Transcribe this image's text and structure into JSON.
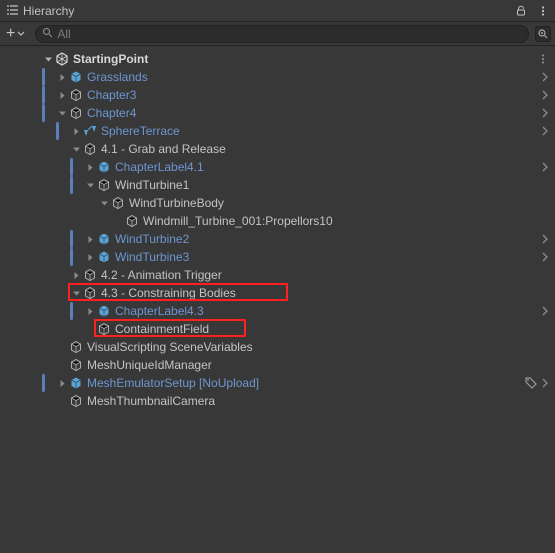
{
  "header": {
    "title": "Hierarchy"
  },
  "search": {
    "placeholder": "All",
    "value": ""
  },
  "root": {
    "label": "StartingPoint",
    "children": [
      {
        "label": "Grasslands",
        "link": true
      },
      {
        "label": "Chapter3",
        "link": true
      },
      {
        "label": "Chapter4",
        "link": true,
        "expanded": true,
        "children": [
          {
            "label": "SphereTerrace",
            "link": true,
            "prefab": true
          },
          {
            "label": "4.1 - Grab and Release",
            "link": false,
            "expanded": true,
            "children": [
              {
                "label": "ChapterLabel4.1",
                "link": true
              },
              {
                "label": "WindTurbine1",
                "link": false,
                "expanded": true,
                "children": [
                  {
                    "label": "WindTurbineBody",
                    "link": false,
                    "expanded": true,
                    "children": [
                      {
                        "label": "Windmill_Turbine_001:Propellors10",
                        "link": false
                      }
                    ]
                  }
                ]
              },
              {
                "label": "WindTurbine2",
                "link": true
              },
              {
                "label": "WindTurbine3",
                "link": true
              }
            ]
          },
          {
            "label": "4.2 - Animation Trigger",
            "link": false
          },
          {
            "label": "4.3 - Constraining Bodies",
            "link": false,
            "expanded": true,
            "children": [
              {
                "label": "ChapterLabel4.3",
                "link": true
              },
              {
                "label": "ContainmentField",
                "link": false
              }
            ]
          }
        ]
      },
      {
        "label": "VisualScripting SceneVariables",
        "link": false
      },
      {
        "label": "MeshUniqueIdManager",
        "link": false
      },
      {
        "label": "MeshEmulatorSetup [NoUpload]",
        "link": true,
        "tagged": true
      },
      {
        "label": "MeshThumbnailCamera",
        "link": false
      }
    ]
  }
}
